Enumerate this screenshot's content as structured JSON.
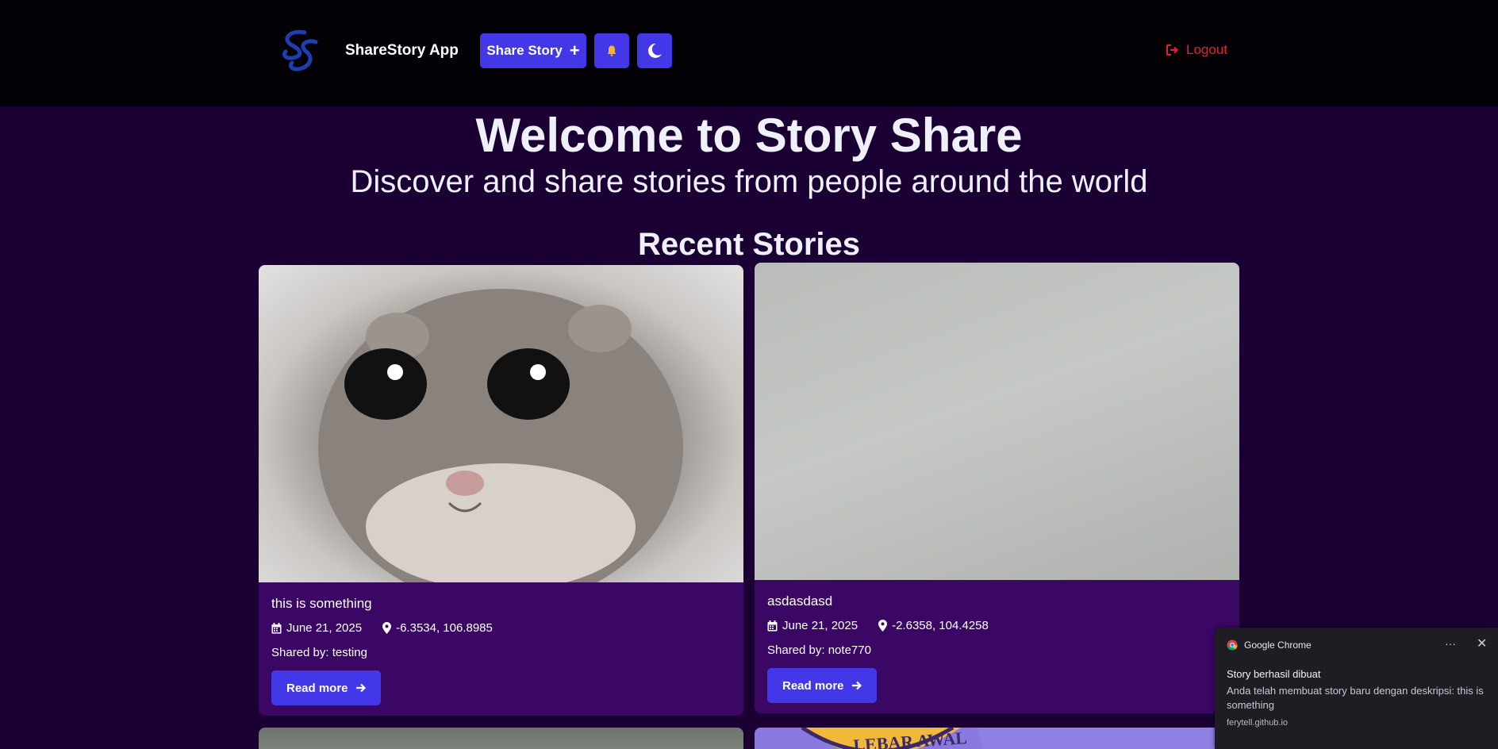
{
  "header": {
    "app_name": "ShareStory App",
    "share_label": "Share Story",
    "share_icon": "plus-icon",
    "notify_icon": "bell-icon",
    "theme_icon": "moon-icon",
    "logout_label": "Logout",
    "logout_icon": "sign-out-icon",
    "colors": {
      "accent": "#4338e8",
      "logout": "#e8202a",
      "logo": "#1e40af"
    }
  },
  "hero": {
    "title": "Welcome to Story Share",
    "subtitle": "Discover and share stories from people around the world"
  },
  "stories_section": {
    "title": "Recent Stories",
    "stories": [
      {
        "image": "hamster-photo",
        "title": "this is something",
        "date": "June 21, 2025",
        "location": "-6.3534, 106.8985",
        "shared_by": "Shared by: testing",
        "read_more": "Read more"
      },
      {
        "image": "gray-wall-photo",
        "title": "asdasdasd",
        "date": "June 21, 2025",
        "location": "-2.6358, 104.4258",
        "shared_by": "Shared by: note770",
        "read_more": "Read more"
      }
    ],
    "partial_card_text": "LEBAR AWAL"
  },
  "notification": {
    "app": "Google Chrome",
    "title": "Story berhasil dibuat",
    "body": "Anda telah membuat story baru dengan deskripsi: this is something",
    "source": "ferytell.github.io",
    "more_icon": "more-icon",
    "close_icon": "close-icon"
  }
}
